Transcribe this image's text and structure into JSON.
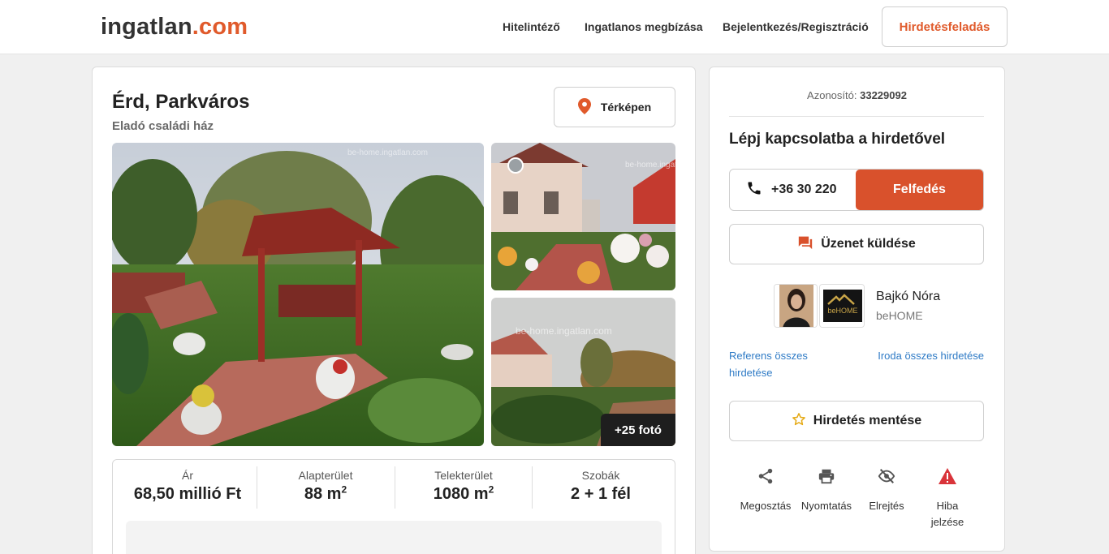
{
  "header": {
    "logo_part1": "ingatlan",
    "logo_part2": ".com",
    "nav": [
      "Hitelintéző",
      "Ingatlanos megbízása",
      "Bejelentkezés/Regisztráció"
    ],
    "post_ad": "Hirdetésfeladás"
  },
  "listing": {
    "title": "Érd, Parkváros",
    "subtitle": "Eladó családi ház",
    "map_button": "Térképen",
    "more_photos": "+25 fotó",
    "watermark": "be-home.ingatlan.com",
    "stats": [
      {
        "label": "Ár",
        "value": "68,50 millió Ft",
        "sup": ""
      },
      {
        "label": "Alapterület",
        "value": "88 m",
        "sup": "2"
      },
      {
        "label": "Telekterület",
        "value": "1080 m",
        "sup": "2"
      },
      {
        "label": "Szobák",
        "value": "2 + 1 fél",
        "sup": ""
      }
    ]
  },
  "contact": {
    "id_label": "Azonosító:",
    "id_value": "33229092",
    "title": "Lépj kapcsolatba a hirdetővel",
    "phone": "+36 30 220",
    "reveal": "Felfedés",
    "message": "Üzenet küldése",
    "agent_name": "Bajkó Nóra",
    "agency": "beHOME",
    "logo_text": "beHOME",
    "link_agent": "Referens összes hirdetése",
    "link_office": "Iroda összes hirdetése",
    "save": "Hirdetés mentése",
    "actions": [
      "Megosztás",
      "Nyomtatás",
      "Elrejtés",
      "Hiba jelzése"
    ]
  },
  "colors": {
    "brand": "#e05a2b",
    "reveal_button": "#d9512c",
    "link": "#2f7bc6",
    "warning": "#d9343a"
  },
  "icons": [
    "map-pin-icon",
    "phone-icon",
    "chat-icon",
    "star-icon",
    "share-icon",
    "print-icon",
    "hide-icon",
    "warning-icon"
  ]
}
